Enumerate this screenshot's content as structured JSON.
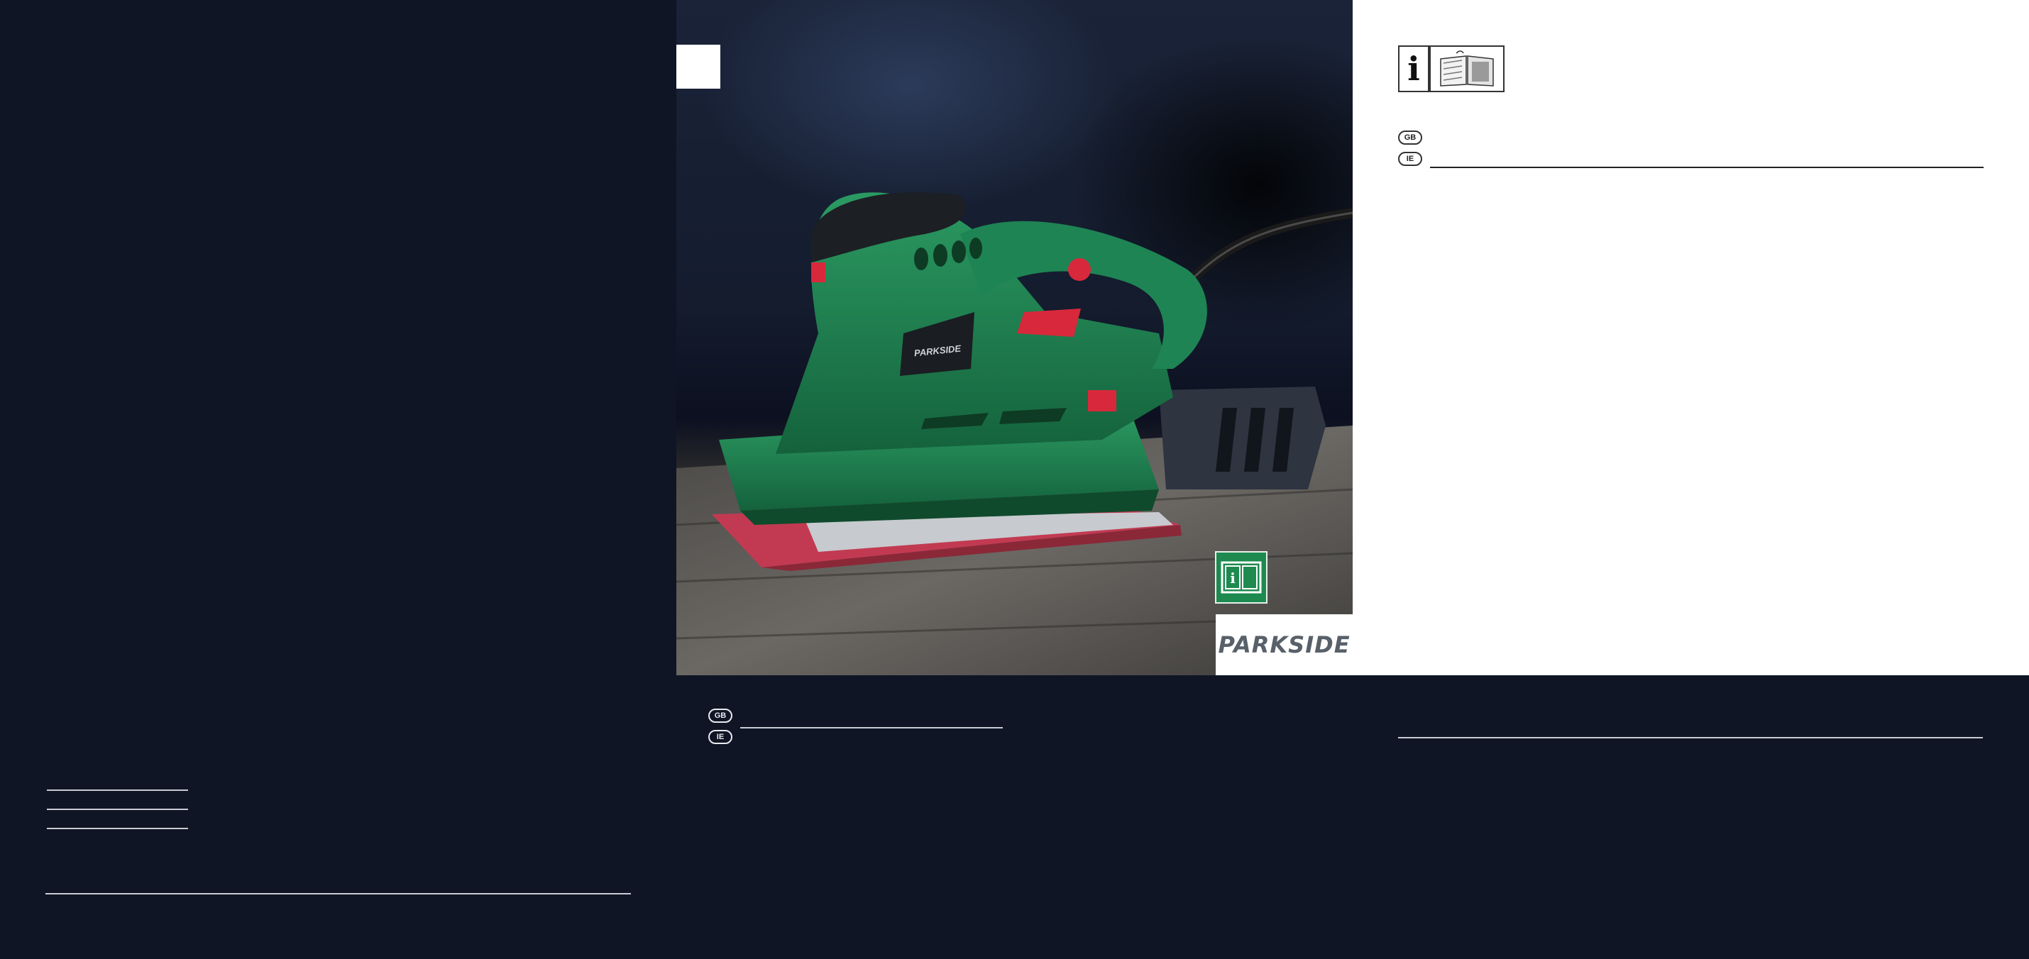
{
  "brand": {
    "logo_text": "PARKSIDE"
  },
  "photo": {
    "product_logo_text": "PARKSIDE"
  },
  "front_cover": {
    "info_icon": "info-icon",
    "manual_icon": "open-book-icon",
    "countries": [
      "GB",
      "IE"
    ]
  },
  "bottom_center": {
    "countries": [
      "GB",
      "IE"
    ]
  },
  "colors": {
    "background": "#0f1524",
    "product_green": "#1e7a4e",
    "accent_red": "#d8283c",
    "badge_green": "#1e8a50",
    "logo_gray": "#58606a"
  }
}
